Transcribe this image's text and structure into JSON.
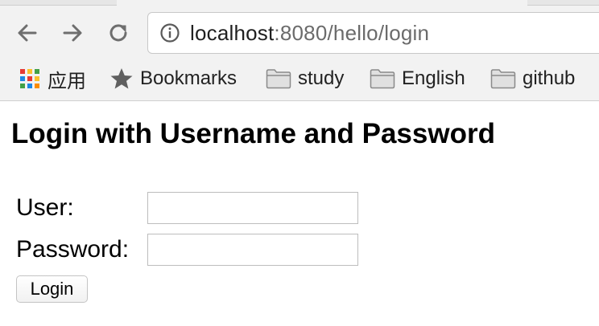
{
  "browser": {
    "url_host": "localhost",
    "url_rest": ":8080/hello/login",
    "nav": {
      "back_icon": "back-arrow-icon",
      "forward_icon": "forward-arrow-icon",
      "reload_icon": "reload-icon",
      "info_icon": "info-icon"
    },
    "bookmarks": {
      "apps_label": "应用",
      "bookmarks_label": "Bookmarks",
      "folders": [
        "study",
        "English",
        "github"
      ]
    }
  },
  "page": {
    "title": "Login with Username and Password",
    "form": {
      "user_label": "User:",
      "user_value": "",
      "password_label": "Password:",
      "password_value": "",
      "submit_label": "Login"
    }
  }
}
